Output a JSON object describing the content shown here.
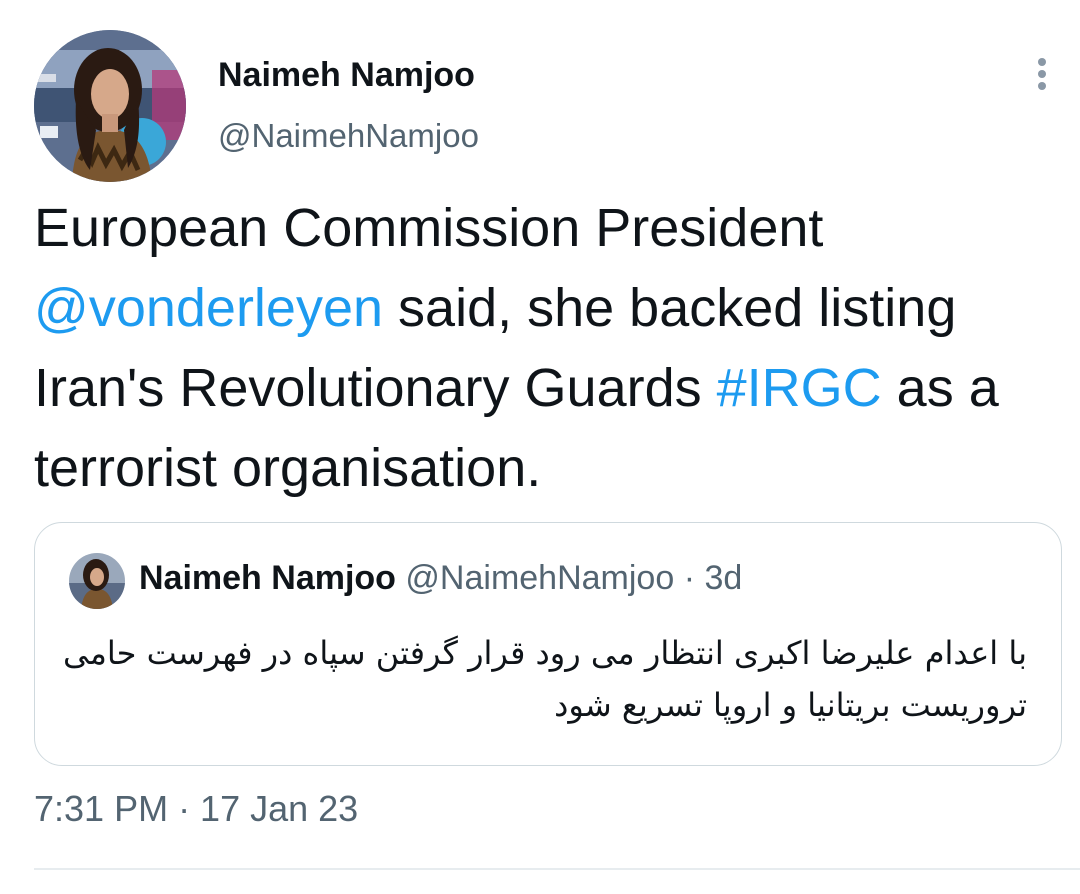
{
  "author": {
    "display_name": "Naimeh Namjoo",
    "handle": "@NaimehNamjoo"
  },
  "tweet": {
    "text_part1": "European Commission President ",
    "mention": "@vonderleyen",
    "text_part2": " said, she backed listing Iran's Revolutionary Guards ",
    "hashtag": "#IRGC",
    "text_part3": " as a terrorist organisation.",
    "timestamp": "7:31 PM · 17 Jan 23"
  },
  "quoted_tweet": {
    "display_name": "Naimeh Namjoo",
    "handle": "@NaimehNamjoo",
    "separator": "·",
    "time": "3d",
    "text": "با اعدام علیرضا اکبری انتظار می رود قرار گرفتن سپاه در فهرست حامی تروریست بریتانیا و اروپا تسریع شود"
  },
  "icons": {
    "more": "more-vertical-icon",
    "avatar": "profile-avatar",
    "quote_avatar": "quote-avatar"
  },
  "colors": {
    "text": "#0f1419",
    "secondary": "#536471",
    "link": "#1d9bf0",
    "border": "#cfd9de"
  }
}
